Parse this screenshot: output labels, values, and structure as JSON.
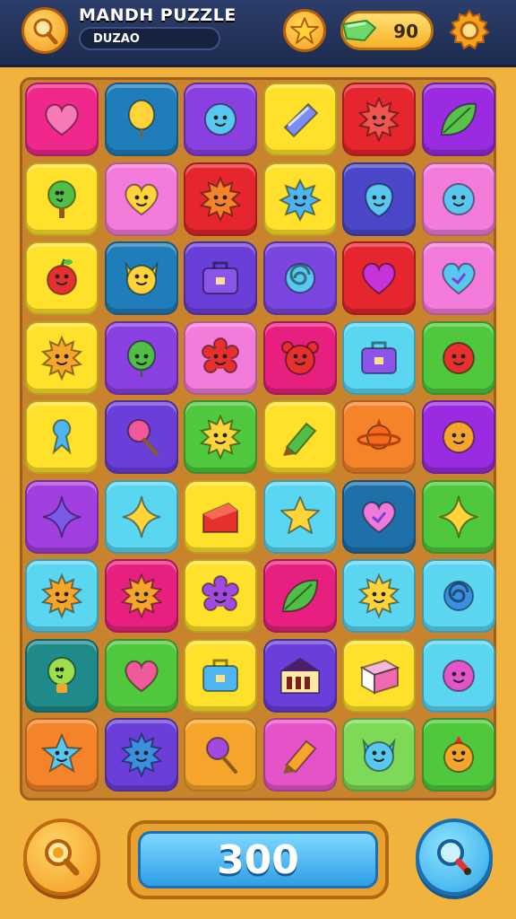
{
  "header": {
    "title": "MANDH PUZZLE",
    "subtitle": "DUZAO",
    "coins": "90"
  },
  "footer": {
    "score": "300"
  },
  "board": {
    "rows": 9,
    "cols": 6,
    "tiles": [
      {
        "color": "#F0288C",
        "icon": "heart-icon",
        "ic": "#F77AB6"
      },
      {
        "color": "#1F7DB9",
        "icon": "balloon-icon",
        "ic": "#FFD43B"
      },
      {
        "color": "#8A3FE0",
        "icon": "smiley-face-icon",
        "ic": "#59C8F0"
      },
      {
        "color": "#FFE12B",
        "icon": "crystal-icon",
        "ic": "#7C8CF0"
      },
      {
        "color": "#E5262E",
        "icon": "sun-face-icon",
        "ic": "#F2554F"
      },
      {
        "color": "#9A2BE0",
        "icon": "leaf-icon",
        "ic": "#59C24A"
      },
      {
        "color": "#FFE12B",
        "icon": "tree-face-icon",
        "ic": "#4FBF45"
      },
      {
        "color": "#F37BD9",
        "icon": "heart-face-icon",
        "ic": "#FFD43B"
      },
      {
        "color": "#E5262E",
        "icon": "sun-face-icon",
        "ic": "#F5832A"
      },
      {
        "color": "#FFE12B",
        "icon": "star-burst-icon",
        "ic": "#4DB5F0"
      },
      {
        "color": "#4A48C9",
        "icon": "drop-face-icon",
        "ic": "#59C8F0"
      },
      {
        "color": "#F37BD9",
        "icon": "smiley-face-icon",
        "ic": "#59C8F0"
      },
      {
        "color": "#FFE12B",
        "icon": "apple-face-icon",
        "ic": "#E5302E"
      },
      {
        "color": "#1F7DB9",
        "icon": "cat-face-icon",
        "ic": "#FFD43B"
      },
      {
        "color": "#6A3FD9",
        "icon": "briefcase-icon",
        "ic": "#8B55EA"
      },
      {
        "color": "#7B45E0",
        "icon": "swirl-icon",
        "ic": "#59C8F0"
      },
      {
        "color": "#E5262E",
        "icon": "heart-icon",
        "ic": "#C533D9"
      },
      {
        "color": "#F37BD9",
        "icon": "heart-check-icon",
        "ic": "#59C8F0"
      },
      {
        "color": "#FFE12B",
        "icon": "sun-face-icon",
        "ic": "#F5A52A"
      },
      {
        "color": "#8A3FE0",
        "icon": "balloon-face-icon",
        "ic": "#4FBF45"
      },
      {
        "color": "#F37BD9",
        "icon": "flower-face-icon",
        "ic": "#E5302E"
      },
      {
        "color": "#E7207F",
        "icon": "bear-face-icon",
        "ic": "#E5302E"
      },
      {
        "color": "#5BD6F0",
        "icon": "briefcase-icon",
        "ic": "#8B55EA"
      },
      {
        "color": "#4FC83E",
        "icon": "smiley-face-icon",
        "ic": "#E5302E"
      },
      {
        "color": "#FFE12B",
        "icon": "ribbon-icon",
        "ic": "#4DB5F0"
      },
      {
        "color": "#6A3FD9",
        "icon": "lollipop-icon",
        "ic": "#F05A9A"
      },
      {
        "color": "#4FC83E",
        "icon": "sun-face-icon",
        "ic": "#FFD43B"
      },
      {
        "color": "#FFE12B",
        "icon": "crayon-icon",
        "ic": "#4FBF45"
      },
      {
        "color": "#F5832A",
        "icon": "planet-icon",
        "ic": "#F56A1E"
      },
      {
        "color": "#9A2BE0",
        "icon": "smiley-face-icon",
        "ic": "#F5A52A"
      },
      {
        "color": "#A23FE0",
        "icon": "diamond-star-icon",
        "ic": "#7B5AEA"
      },
      {
        "color": "#5BD6F0",
        "icon": "diamond-star-icon",
        "ic": "#FFD43B"
      },
      {
        "color": "#FFE12B",
        "icon": "cheese-box-icon",
        "ic": "#E5302E"
      },
      {
        "color": "#5BD6F0",
        "icon": "star-icon",
        "ic": "#FFD43B"
      },
      {
        "color": "#1F6FA8",
        "icon": "heart-check-icon",
        "ic": "#F07AD9"
      },
      {
        "color": "#4FC83E",
        "icon": "diamond-star-icon",
        "ic": "#FFD43B"
      },
      {
        "color": "#5BD6F0",
        "icon": "sun-face-icon",
        "ic": "#F5A52A"
      },
      {
        "color": "#E7207F",
        "icon": "sun-face-icon",
        "ic": "#F5A52A"
      },
      {
        "color": "#FFE12B",
        "icon": "flower-face-icon",
        "ic": "#A24AE0"
      },
      {
        "color": "#E7207F",
        "icon": "leaf-icon",
        "ic": "#4FBF45"
      },
      {
        "color": "#5BD6F0",
        "icon": "sun-face-icon",
        "ic": "#FFD43B"
      },
      {
        "color": "#5BD6F0",
        "icon": "swirl-icon",
        "ic": "#3A8FE0"
      },
      {
        "color": "#1E8A8A",
        "icon": "bulb-face-icon",
        "ic": "#9DE04A"
      },
      {
        "color": "#4FC83E",
        "icon": "heart-icon",
        "ic": "#F05A9A"
      },
      {
        "color": "#FFE12B",
        "icon": "briefcase-icon",
        "ic": "#4DB5F0"
      },
      {
        "color": "#6A3FD9",
        "icon": "house-icon",
        "ic": "#F5A52A"
      },
      {
        "color": "#FFE12B",
        "icon": "cube-icon",
        "ic": "#F06AB0"
      },
      {
        "color": "#5BD6F0",
        "icon": "smiley-face-icon",
        "ic": "#E553C9"
      },
      {
        "color": "#F5832A",
        "icon": "star-face-icon",
        "ic": "#59C8F0"
      },
      {
        "color": "#6A3FD9",
        "icon": "sun-face-icon",
        "ic": "#3A8FE0"
      },
      {
        "color": "#F5A52A",
        "icon": "lollipop-icon",
        "ic": "#A24AE0"
      },
      {
        "color": "#E553C9",
        "icon": "crayon-icon",
        "ic": "#F5A52A"
      },
      {
        "color": "#7ED957",
        "icon": "cat-face-icon",
        "ic": "#59C8F0"
      },
      {
        "color": "#4FC83E",
        "icon": "bird-face-icon",
        "ic": "#F5A52A"
      }
    ]
  }
}
